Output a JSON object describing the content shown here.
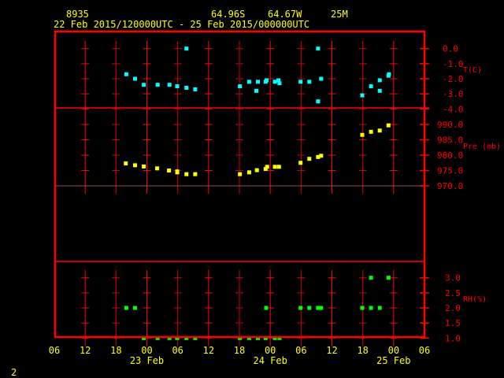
{
  "header": {
    "station": "8935",
    "lat": "64.96S",
    "lon": "64.67W",
    "elev": "25M",
    "period": "22 Feb 2015/120000UTC - 25 Feb 2015/000000UTC"
  },
  "footer": {
    "page": "2"
  },
  "colors": {
    "frame": "#ff0000",
    "text": "#ffff00",
    "temp": "#00ffff",
    "pres": "#ffff00",
    "rh": "#00ff00"
  },
  "chart_data": {
    "type": "scatter",
    "x_units": "hours since 22 Feb 2015 06 UTC",
    "xlim": [
      0,
      72
    ],
    "x_ticks": [
      {
        "h": 0,
        "label": "06"
      },
      {
        "h": 6,
        "label": "12"
      },
      {
        "h": 12,
        "label": "18"
      },
      {
        "h": 18,
        "label": "00"
      },
      {
        "h": 24,
        "label": "06"
      },
      {
        "h": 30,
        "label": "12"
      },
      {
        "h": 36,
        "label": "18"
      },
      {
        "h": 42,
        "label": "00"
      },
      {
        "h": 48,
        "label": "06"
      },
      {
        "h": 54,
        "label": "12"
      },
      {
        "h": 60,
        "label": "18"
      },
      {
        "h": 66,
        "label": "00"
      },
      {
        "h": 72,
        "label": "06"
      }
    ],
    "date_labels": [
      {
        "h": 18,
        "label": "23 Feb"
      },
      {
        "h": 42,
        "label": "24 Feb"
      },
      {
        "h": 66,
        "label": "25 Feb"
      }
    ],
    "panels": [
      {
        "name": "temperature",
        "ylabel": "T(C)",
        "ylim": [
          -4.0,
          0.4
        ],
        "y_ticks": [
          {
            "v": 0,
            "label": "0.0"
          },
          {
            "v": -1,
            "label": "-1.0"
          },
          {
            "v": -2,
            "label": "-2.0"
          },
          {
            "v": -3,
            "label": "-3.0"
          },
          {
            "v": -4,
            "label": "-4.0"
          }
        ],
        "points": [
          [
            14.0,
            -1.7
          ],
          [
            15.7,
            -2.0
          ],
          [
            17.4,
            -2.4
          ],
          [
            20.1,
            -2.4
          ],
          [
            22.4,
            -2.4
          ],
          [
            23.9,
            -2.5
          ],
          [
            25.7,
            0.0
          ],
          [
            25.7,
            -2.6
          ],
          [
            27.4,
            -2.7
          ],
          [
            36.1,
            -2.5
          ],
          [
            37.9,
            -2.2
          ],
          [
            39.6,
            -2.2
          ],
          [
            39.3,
            -2.8
          ],
          [
            41.1,
            -2.2
          ],
          [
            41.3,
            -2.1
          ],
          [
            42.9,
            -2.2
          ],
          [
            43.6,
            -2.1
          ],
          [
            43.8,
            -2.3
          ],
          [
            47.9,
            -2.2
          ],
          [
            49.6,
            -2.2
          ],
          [
            51.3,
            0.0
          ],
          [
            51.3,
            -3.5
          ],
          [
            51.9,
            -2.0
          ],
          [
            59.9,
            -3.1
          ],
          [
            61.6,
            -2.5
          ],
          [
            63.3,
            -2.1
          ],
          [
            63.3,
            -2.8
          ],
          [
            65.0,
            -1.8
          ],
          [
            65.1,
            -1.7
          ]
        ]
      },
      {
        "name": "pressure",
        "ylabel": "Pre (mb)",
        "ylim": [
          965,
          995.5
        ],
        "y_ticks": [
          {
            "v": 990,
            "label": "990.0"
          },
          {
            "v": 985,
            "label": "985.0"
          },
          {
            "v": 980,
            "label": "980.0"
          },
          {
            "v": 975,
            "label": "975.0"
          },
          {
            "v": 970,
            "label": "970.0"
          }
        ],
        "points": [
          [
            13.9,
            977.3
          ],
          [
            15.7,
            976.7
          ],
          [
            17.4,
            976.3
          ],
          [
            20.0,
            975.7
          ],
          [
            22.3,
            975.0
          ],
          [
            23.9,
            974.7
          ],
          [
            23.9,
            974.4
          ],
          [
            25.7,
            973.8
          ],
          [
            27.4,
            973.8
          ],
          [
            36.1,
            973.8
          ],
          [
            37.9,
            974.4
          ],
          [
            39.4,
            975.1
          ],
          [
            41.1,
            975.5
          ],
          [
            41.4,
            976.2
          ],
          [
            42.9,
            976.2
          ],
          [
            43.7,
            976.2
          ],
          [
            47.9,
            977.5
          ],
          [
            49.6,
            978.8
          ],
          [
            51.3,
            979.4
          ],
          [
            51.9,
            979.8
          ],
          [
            59.9,
            986.6
          ],
          [
            61.6,
            987.6
          ],
          [
            63.3,
            988.0
          ],
          [
            65.0,
            989.7
          ]
        ]
      },
      {
        "name": "relative-humidity",
        "ylabel": "RH(%)",
        "ylim": [
          1.0,
          3.5
        ],
        "y_ticks": [
          {
            "v": 3.0,
            "label": "3.0"
          },
          {
            "v": 2.5,
            "label": "2.5"
          },
          {
            "v": 2.0,
            "label": "2.0"
          },
          {
            "v": 1.5,
            "label": "1.5"
          },
          {
            "v": 1.0,
            "label": "1.0"
          }
        ],
        "points": [
          [
            14.0,
            2.0
          ],
          [
            15.7,
            2.0
          ],
          [
            41.2,
            2.0
          ],
          [
            47.9,
            2.0
          ],
          [
            49.6,
            2.0
          ],
          [
            51.3,
            2.0
          ],
          [
            51.9,
            2.0
          ],
          [
            59.9,
            2.0
          ],
          [
            61.6,
            2.0
          ],
          [
            63.3,
            2.0
          ],
          [
            61.6,
            3.0
          ],
          [
            65.0,
            3.0
          ],
          [
            17.4,
            1.0
          ],
          [
            20.1,
            1.0
          ],
          [
            22.4,
            1.0
          ],
          [
            23.9,
            1.0
          ],
          [
            25.7,
            1.0
          ],
          [
            27.4,
            1.0
          ],
          [
            36.1,
            1.0
          ],
          [
            37.9,
            1.0
          ],
          [
            39.6,
            1.0
          ],
          [
            41.1,
            1.0
          ],
          [
            42.9,
            1.0
          ],
          [
            43.8,
            1.0
          ]
        ]
      }
    ]
  }
}
